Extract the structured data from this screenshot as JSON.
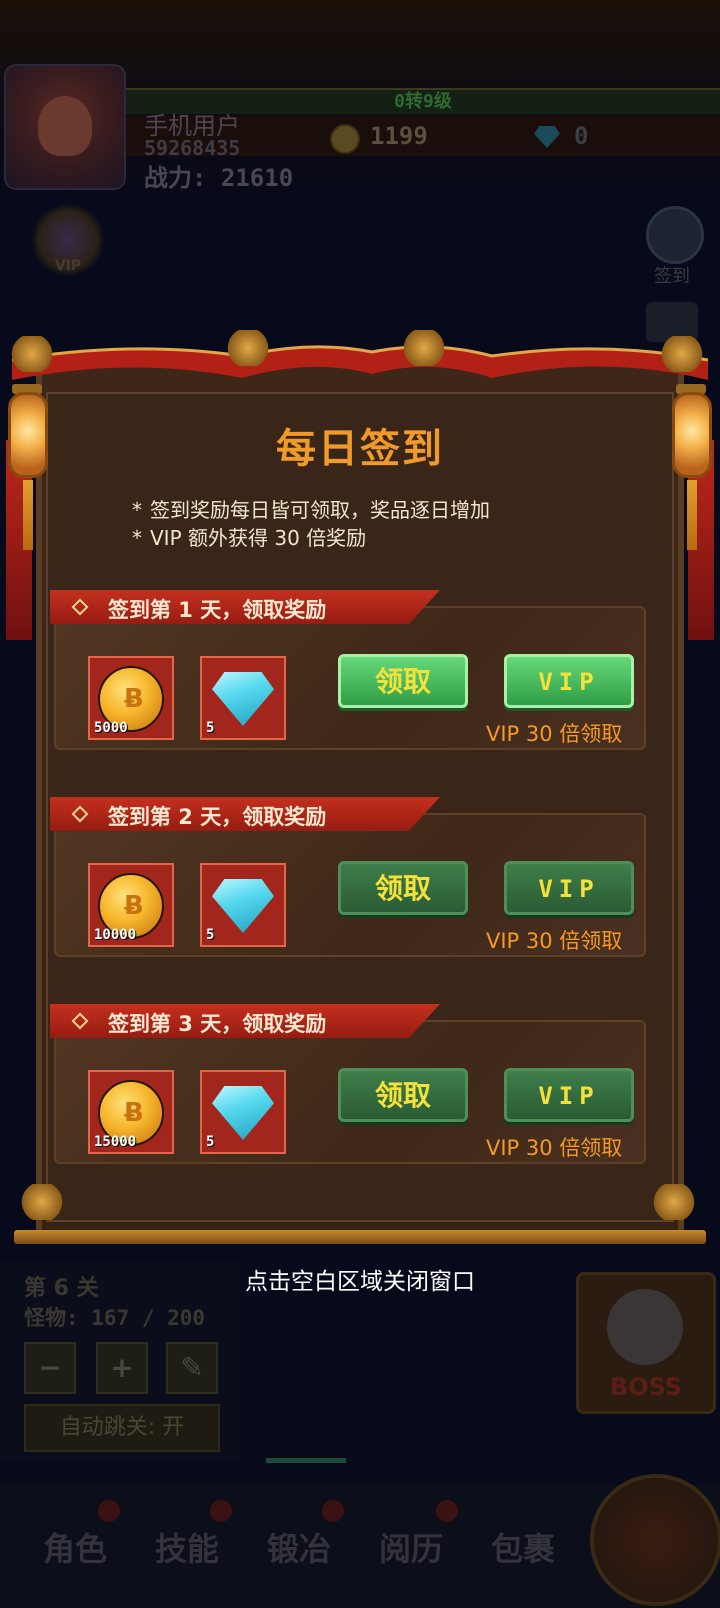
{
  "hud": {
    "level": "0转9级",
    "user_name": "手机用户",
    "user_id": "59268435",
    "power": "战力: 21610",
    "coins": "1199",
    "gems": "0",
    "vip_label": "VIP",
    "signin_label": "签到"
  },
  "stage": {
    "title": "第 6 关",
    "monsters": "怪物: 167 / 200",
    "minus": "−",
    "plus": "+",
    "auto_jump": "自动跳关: 开",
    "boss": "BOSS"
  },
  "nav": [
    "角色",
    "技能",
    "锻冶",
    "阅历",
    "包裹"
  ],
  "dialog": {
    "title": "每日签到",
    "rules": [
      "签到奖励每日皆可领取，奖品逐日增加",
      "VIP 额外获得 30 倍奖励"
    ],
    "rule_bullet": "*",
    "days": [
      {
        "header": "签到第 1 天，领取奖励",
        "coins": "5000",
        "gems": "5",
        "claim": "领取",
        "vip": "VIP",
        "note": "VIP 30 倍领取",
        "state": "active"
      },
      {
        "header": "签到第 2 天，领取奖励",
        "coins": "10000",
        "gems": "5",
        "claim": "领取",
        "vip": "VIP",
        "note": "VIP 30 倍领取",
        "state": "locked"
      },
      {
        "header": "签到第 3 天，领取奖励",
        "coins": "15000",
        "gems": "5",
        "claim": "领取",
        "vip": "VIP",
        "note": "VIP 30 倍领取",
        "state": "locked"
      }
    ],
    "close_hint": "点击空白区域关闭窗口"
  },
  "colors": {
    "title": "#f09a2a",
    "header_red": "#c4301e",
    "button_green": "#66d878",
    "button_text": "#f4e23a",
    "vip_note": "#f59a26"
  }
}
